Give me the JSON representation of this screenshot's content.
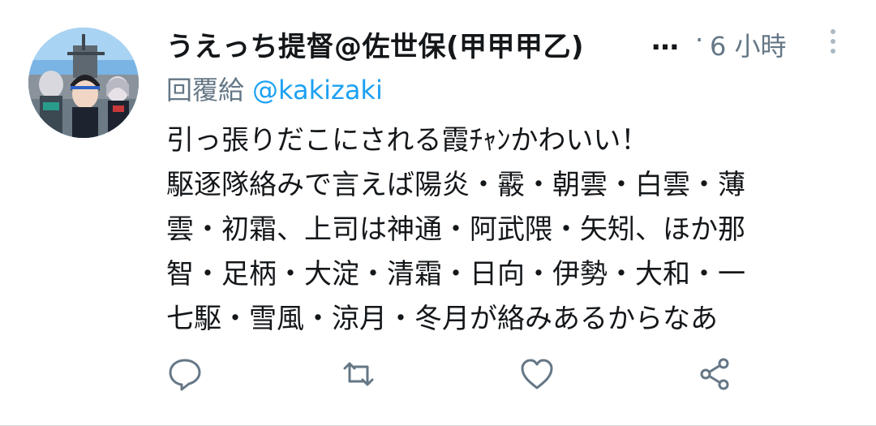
{
  "tweet": {
    "display_name": "うえっち提督@佐世保(甲甲甲乙)",
    "ellipsis": "…",
    "separator": "·",
    "timestamp": "6 小時",
    "reply_label": "回覆給",
    "reply_handle": "@kakizaki",
    "text_lines": [
      "引っ張りだこにされる霞ﾁｬﾝかわいい！",
      "駆逐隊絡みで言えば陽炎・霰・朝雲・白雲・薄",
      "雲・初霜、上司は神通・阿武隈・矢矧、ほか那",
      "智・足柄・大淀・清霜・日向・伊勢・大和・一",
      "七駆・雪風・涼月・冬月が絡みあるからなあ"
    ]
  },
  "actions": {
    "reply_icon": "reply-icon",
    "retweet_icon": "retweet-icon",
    "like_icon": "heart-icon",
    "share_icon": "share-icon"
  },
  "colors": {
    "primary_text": "#14171a",
    "secondary_text": "#657786",
    "link": "#1da1f2",
    "icon": "#657786"
  }
}
